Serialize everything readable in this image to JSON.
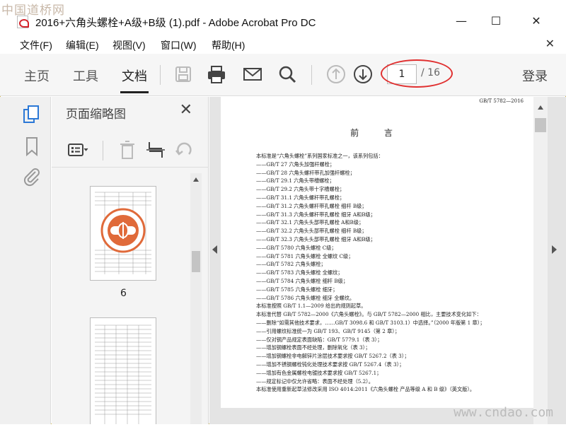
{
  "window": {
    "watermark_top": "中国道桥网",
    "title": "2016+六角头螺栓+A级+B级 (1).pdf - Adobe Acrobat Pro DC",
    "minimize": "—",
    "maximize": "☐",
    "close": "✕"
  },
  "menu": {
    "items": [
      "文件(F)",
      "编辑(E)",
      "视图(V)",
      "窗口(W)",
      "帮助(H)"
    ],
    "close": "✕"
  },
  "toolbar": {
    "tabs": [
      "主页",
      "工具",
      "文档"
    ],
    "active_tab": "文档",
    "page_current": "1",
    "page_total": "/ 16",
    "login": "登录"
  },
  "thumb_panel": {
    "title": "页面缩略图",
    "close": "✕",
    "thumbs": [
      {
        "label": "6"
      },
      {
        "label": ""
      }
    ]
  },
  "document": {
    "standard_no": "GB/T 5782—2016",
    "preface_title": "前 言",
    "lines": [
      "本标准是“六角头螺栓”系列国家标准之一，该系列包括：",
      "——GB/T 27  六角头加强杆螺栓；",
      "——GB/T 28  六角头螺杆带孔加强杆螺栓；",
      "——GB/T 29.1  六角头带槽螺栓；",
      "——GB/T 29.2  六角头带十字槽螺栓；",
      "——GB/T 31.1  六角头螺杆带孔螺栓；",
      "——GB/T 31.2  六角头螺杆带孔螺栓  细杆  B级；",
      "——GB/T 31.3  六角头螺杆带孔螺栓  细牙  A和B级；",
      "——GB/T 32.1  六角头头部带孔螺栓  A和B级；",
      "——GB/T 32.2  六角头头部带孔螺栓  细杆  B级；",
      "——GB/T 32.3  六角头头部带孔螺栓  细牙  A和B级；",
      "——GB/T 5780  六角头螺栓  C级；",
      "——GB/T 5781  六角头螺栓  全螺纹  C级；",
      "——GB/T 5782  六角头螺栓；",
      "——GB/T 5783  六角头螺栓  全螺纹；",
      "——GB/T 5784  六角头螺栓  细杆  B级；",
      "——GB/T 5785  六角头螺栓  细牙；",
      "——GB/T 5786  六角头螺栓  细牙  全螺纹。",
      "本标准按照 GB/T 1.1—2009 给出的规则起草。",
      "本标准代替 GB/T 5782—2000《六角头螺栓》。与 GB/T 5782—2000 相比，主要技术变化如下：",
      "——删除“如需其他技术要求，……GB/T 3098.6 和 GB/T 3103.1）中选择。”（2000 年版第 1 章）；",
      "——引用螺纹标准统一为 GB/T 193、GB/T 9145（第 2 章）；",
      "——仅对钢产品规定表面缺陷：GB/T 5779.1（表 3）；",
      "——增加钢螺栓表面不经处理，删除氧化（表 3）；",
      "——增加钢螺栓非电解锌片涂层技术要求按 GB/T 5267.2（表 3）；",
      "——增加不锈钢螺栓钝化处理技术要求按 GB/T 5267.4（表 3）；",
      "——增加有色金属螺栓电镀技术要求按 GB/T 5267.1；",
      "——规定标记中仅允许省略：表面不经处理（5.2）。",
      "本标准使用重新起草法修改采用 ISO 4014:2011《六角头螺栓  产品等级 A 和 B 级》（英文版）。"
    ],
    "watermark_bottom": "www.cndao.com"
  }
}
